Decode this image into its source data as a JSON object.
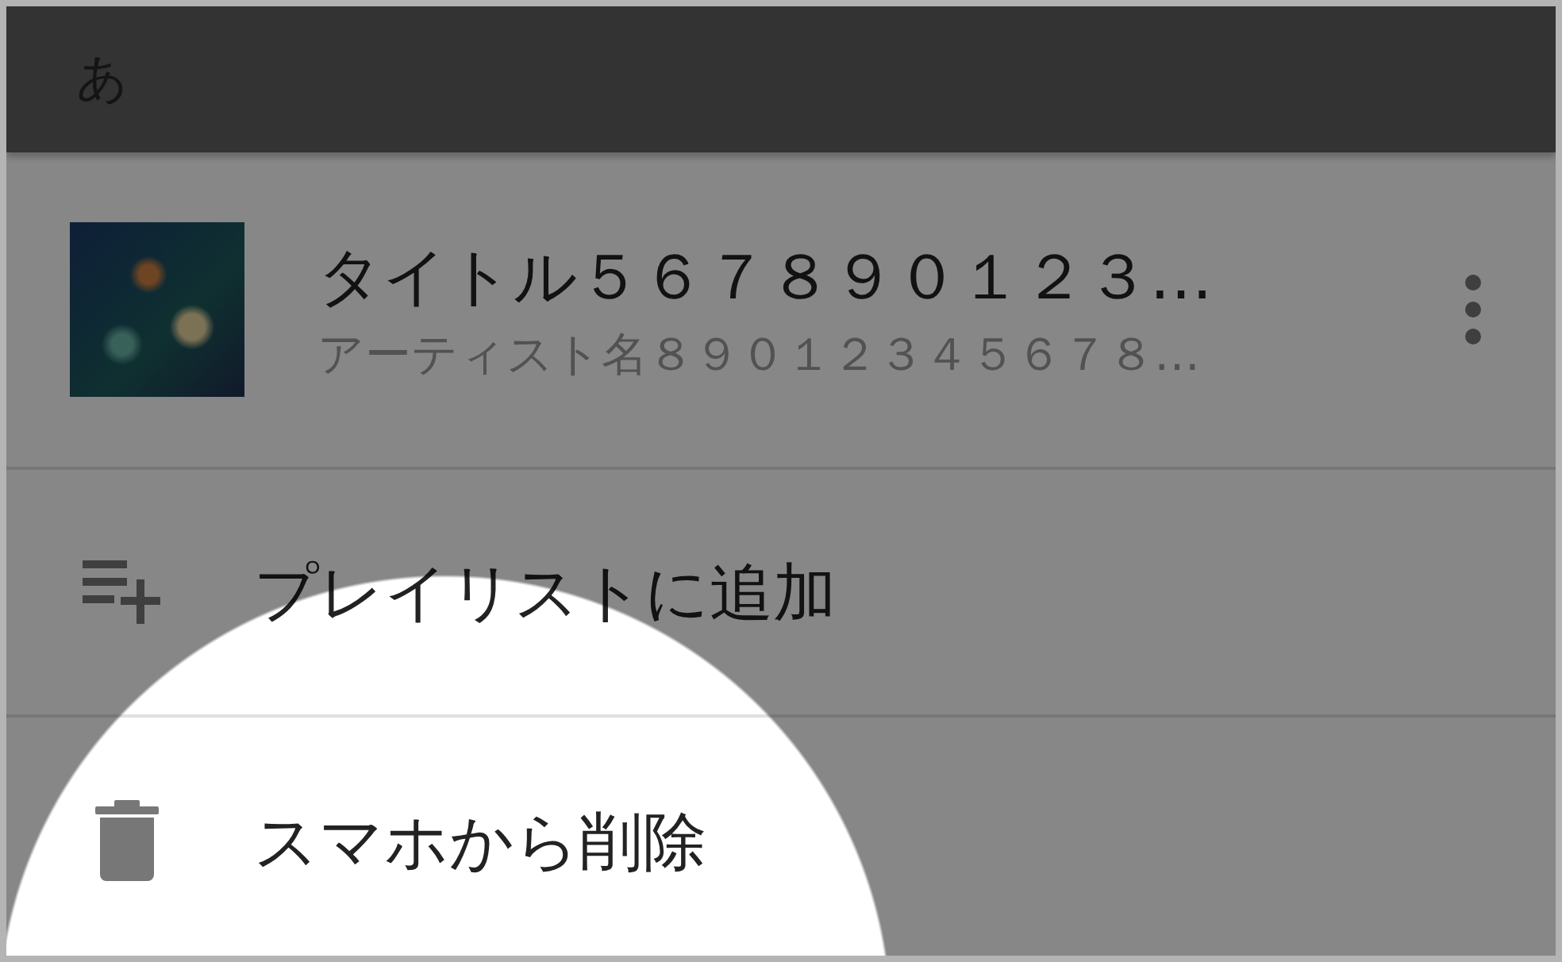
{
  "header": {
    "text": "あ"
  },
  "track": {
    "title": "タイトル５６７８９０１２３…",
    "artist": "アーティスト名８９０１２３４５６７８…"
  },
  "menu": [
    {
      "kind": "add",
      "label": "プレイリストに追加"
    },
    {
      "kind": "delete",
      "label": "スマホから削除"
    }
  ]
}
